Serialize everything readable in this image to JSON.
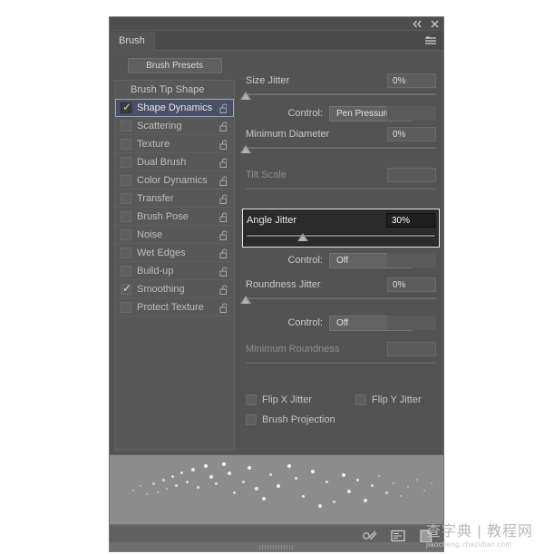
{
  "window": {
    "title": "Brush",
    "collapse_icon": "double-chevron-left-icon",
    "close_icon": "close-icon",
    "flyout_icon": "panel-menu-icon"
  },
  "tabs": [
    {
      "label": "Brush",
      "active": true
    }
  ],
  "sidebar": {
    "presets_button": "Brush Presets",
    "header": "Brush Tip Shape",
    "items": [
      {
        "label": "Shape Dynamics",
        "checked": true,
        "selected": true,
        "lock": "unlock-icon"
      },
      {
        "label": "Scattering",
        "checked": false,
        "selected": false,
        "lock": "unlock-icon"
      },
      {
        "label": "Texture",
        "checked": false,
        "selected": false,
        "lock": "unlock-icon"
      },
      {
        "label": "Dual Brush",
        "checked": false,
        "selected": false,
        "lock": "unlock-icon"
      },
      {
        "label": "Color Dynamics",
        "checked": false,
        "selected": false,
        "lock": "unlock-icon"
      },
      {
        "label": "Transfer",
        "checked": false,
        "selected": false,
        "lock": "unlock-icon"
      },
      {
        "label": "Brush Pose",
        "checked": false,
        "selected": false,
        "lock": "unlock-icon"
      },
      {
        "label": "Noise",
        "checked": false,
        "selected": false,
        "lock": "unlock-icon"
      },
      {
        "label": "Wet Edges",
        "checked": false,
        "selected": false,
        "lock": "unlock-icon"
      },
      {
        "label": "Build-up",
        "checked": false,
        "selected": false,
        "lock": "unlock-icon"
      },
      {
        "label": "Smoothing",
        "checked": true,
        "selected": false,
        "lock": "unlock-icon"
      },
      {
        "label": "Protect Texture",
        "checked": false,
        "selected": false,
        "lock": "unlock-icon"
      }
    ]
  },
  "options": {
    "size_jitter": {
      "label": "Size Jitter",
      "value": "0%",
      "slider_percent": 0
    },
    "size_control": {
      "label": "Control:",
      "value": "Pen Pressure"
    },
    "minimum_diameter": {
      "label": "Minimum Diameter",
      "value": "0%",
      "slider_percent": 0
    },
    "tilt_scale": {
      "label": "Tilt Scale",
      "value": "",
      "slider_percent": 0,
      "disabled": true
    },
    "angle_jitter": {
      "label": "Angle Jitter",
      "value": "30%",
      "slider_percent": 30,
      "highlighted": true
    },
    "angle_control": {
      "label": "Control:",
      "value": "Off"
    },
    "roundness_jitter": {
      "label": "Roundness Jitter",
      "value": "0%",
      "slider_percent": 0
    },
    "roundness_control": {
      "label": "Control:",
      "value": "Off"
    },
    "minimum_roundness": {
      "label": "Minimum Roundness",
      "value": "",
      "disabled": true
    },
    "flip_x_jitter": {
      "label": "Flip X Jitter",
      "checked": false
    },
    "flip_y_jitter": {
      "label": "Flip Y Jitter",
      "checked": false
    },
    "brush_projection": {
      "label": "Brush Projection",
      "checked": false
    }
  },
  "bottom_toolbar": {
    "icons": [
      {
        "name": "toggle-brush-settings-icon"
      },
      {
        "name": "new-brush-preset-icon"
      },
      {
        "name": "create-new-brush-icon"
      }
    ]
  },
  "preview": {
    "alt": "brush-stroke-preview"
  },
  "watermark": {
    "main": "查字典 | 教程网",
    "sub": "jiaocheng.chazidian.com"
  },
  "colors": {
    "panel_bg": "#535353",
    "selected_row": "#4a5066",
    "highlight_bg": "#2b2b2b",
    "highlight_border": "#e6e6e6",
    "preview_bg": "#8c8c8c"
  }
}
